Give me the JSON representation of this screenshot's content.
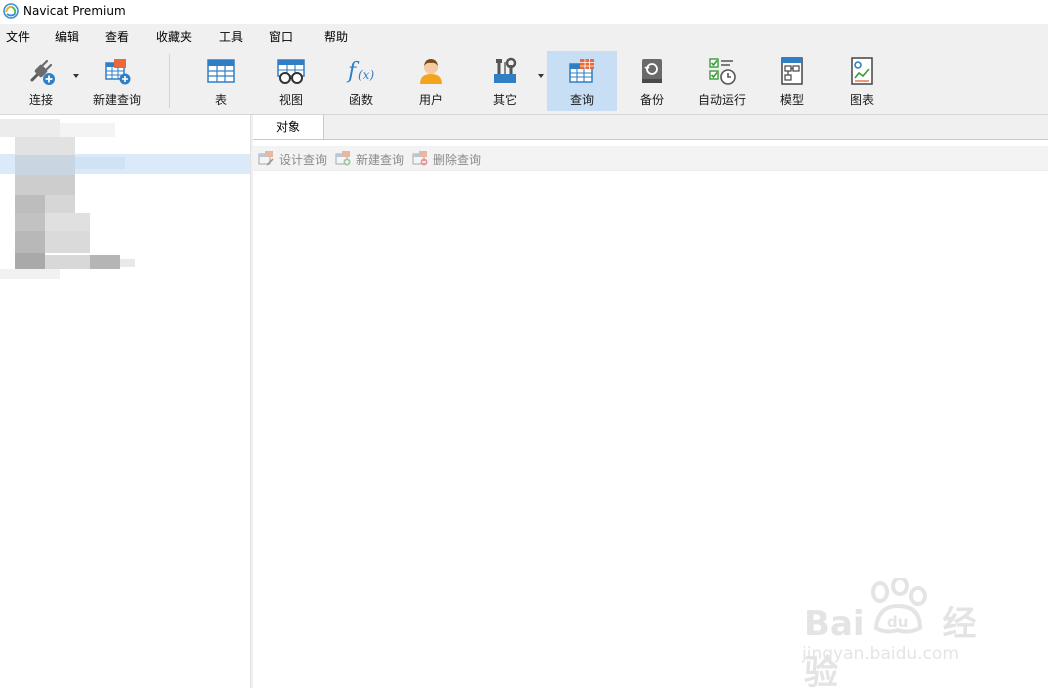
{
  "window": {
    "title": "Navicat Premium"
  },
  "menu": [
    "文件",
    "编辑",
    "查看",
    "收藏夹",
    "工具",
    "窗口",
    "帮助"
  ],
  "toolbar": {
    "connect": "连接",
    "new_query": "新建查询",
    "table": "表",
    "view": "视图",
    "function": "函数",
    "user": "用户",
    "other": "其它",
    "query": "查询",
    "backup": "备份",
    "automation": "自动运行",
    "model": "模型",
    "chart": "图表",
    "active": "查询"
  },
  "tabs": [
    {
      "label": "对象"
    }
  ],
  "object_toolbar": {
    "design_query": "设计查询",
    "new_query": "新建查询",
    "delete_query": "删除查询"
  },
  "watermark": {
    "text": "Bai经验",
    "paw_text": "du",
    "url": "jingyan.baidu.com"
  },
  "colors": {
    "menubar": "#f0f0f0",
    "active_tool": "#c7def5",
    "selection": "#dbeaf8",
    "accent_blue": "#2f7fc5",
    "disabled_text": "#8a8a8a"
  }
}
